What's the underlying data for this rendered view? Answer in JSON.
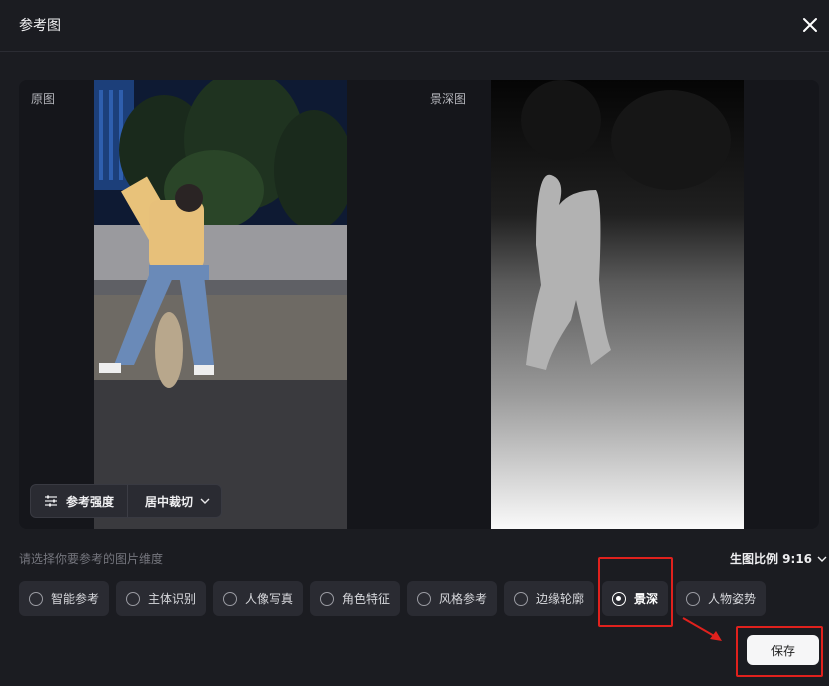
{
  "dialog": {
    "title": "参考图"
  },
  "preview": {
    "original_label": "原图",
    "depth_label": "景深图",
    "strength_label": "参考强度",
    "crop_label": "居中裁切"
  },
  "selector": {
    "prompt": "请选择你要参考的图片维度",
    "ratio_label": "生图比例 9:16",
    "options": [
      {
        "label": "智能参考",
        "selected": false
      },
      {
        "label": "主体识别",
        "selected": false
      },
      {
        "label": "人像写真",
        "selected": false
      },
      {
        "label": "角色特征",
        "selected": false
      },
      {
        "label": "风格参考",
        "selected": false
      },
      {
        "label": "边缘轮廓",
        "selected": false
      },
      {
        "label": "景深",
        "selected": true
      },
      {
        "label": "人物姿势",
        "selected": false
      }
    ]
  },
  "footer": {
    "save_label": "保存"
  },
  "colors": {
    "highlight": "#e0211d",
    "background": "#1b1c21",
    "chip": "#2a2b32"
  }
}
